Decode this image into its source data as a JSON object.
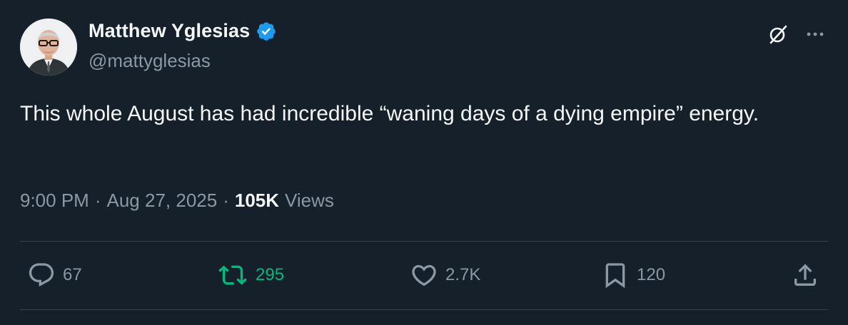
{
  "author": {
    "display_name": "Matthew Yglesias",
    "handle": "@mattyglesias",
    "verified": true
  },
  "tweet": {
    "text": "This whole August has had incredible “waning days of a dying empire” energy."
  },
  "meta": {
    "time": "9:00 PM",
    "separator": "·",
    "date": "Aug 27, 2025",
    "views_count": "105K",
    "views_label": "Views"
  },
  "actions": {
    "replies": "67",
    "retweets": "295",
    "likes": "2.7K",
    "bookmarks": "120"
  },
  "icons": {
    "verified": "verified-badge-icon",
    "grok": "grok-icon",
    "more": "more-icon",
    "reply": "reply-icon",
    "retweet": "retweet-icon",
    "like": "heart-icon",
    "bookmark": "bookmark-icon",
    "share": "share-icon"
  },
  "colors": {
    "background": "#15202b",
    "primary_text": "#f7f9f9",
    "secondary_text": "#8b98a5",
    "verified": "#1d9bf0",
    "retweet_active": "#00ba7c",
    "divider": "#38444d"
  }
}
